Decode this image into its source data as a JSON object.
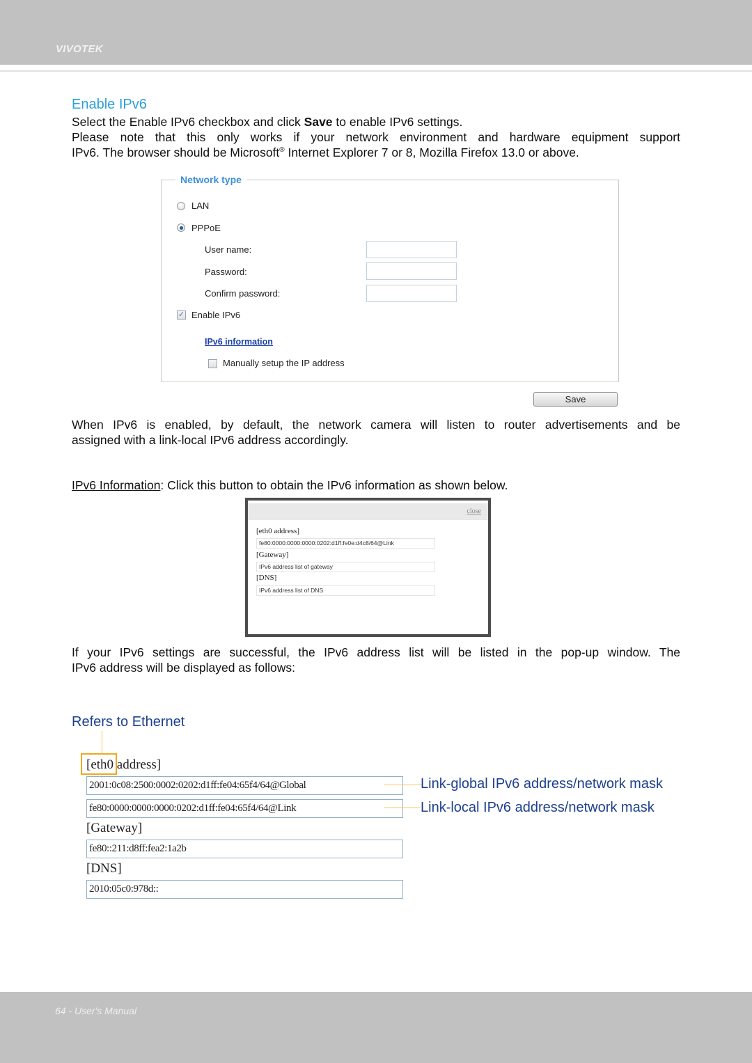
{
  "header": {
    "brand": "VIVOTEK"
  },
  "section1": {
    "title": "Enable IPv6",
    "intro_pre": "Select the Enable IPv6 checkbox and click ",
    "intro_bold": "Save",
    "intro_post": " to enable IPv6 settings.",
    "note_line1": "Please note that this only works if your network environment and hardware equipment support",
    "note_line2_pre": "IPv6. The browser should be Microsoft",
    "note_sup": "®",
    "note_line2_post": " Internet Explorer 7 or 8, Mozilla Firefox 13.0 or above."
  },
  "network_panel": {
    "legend": "Network type",
    "radios": [
      {
        "label": "LAN",
        "checked": false
      },
      {
        "label": "PPPoE",
        "checked": true
      }
    ],
    "fields": [
      {
        "label": "User name:",
        "value": ""
      },
      {
        "label": "Password:",
        "value": ""
      },
      {
        "label": "Confirm password:",
        "value": ""
      }
    ],
    "enable_ipv6": {
      "label": "Enable IPv6",
      "checked": true,
      "mark": "✓"
    },
    "ipv6_info_link": "IPv6 information",
    "manual_setup": {
      "label": "Manually setup the IP address",
      "checked": false
    },
    "save_label": "Save"
  },
  "para_enabled": {
    "line1": "When IPv6 is enabled, by default, the network camera will listen to router advertisements and be",
    "line2": "assigned with a link-local IPv6 address accordingly."
  },
  "para_info": {
    "link_text": "IPv6 Information",
    "rest": ": Click this button to obtain the IPv6 information as shown below."
  },
  "popup": {
    "close": "close",
    "sections": [
      {
        "heading": "[eth0 address]",
        "value": "fe80:0000:0000:0000:0202:d1ff:fe0e:d4c8/64@Link"
      },
      {
        "heading": "[Gateway]",
        "value": "IPv6 address list of gateway"
      },
      {
        "heading": "[DNS]",
        "value": "IPv6 address list of DNS"
      }
    ]
  },
  "para_success": {
    "line1": "If your IPv6 settings are successful, the IPv6 address list will be listed in the pop-up window. The",
    "line2": "IPv6 address will be displayed as follows:"
  },
  "ethernet": {
    "callout": "Refers to Ethernet",
    "eth_head_boxed": "[eth0",
    "eth_head_rest": " address]",
    "global_addr": "2001:0c08:2500:0002:0202:d1ff:fe04:65f4/64@Global",
    "link_addr": "fe80:0000:0000:0000:0202:d1ff:fe04:65f4/64@Link",
    "gateway_head": "[Gateway]",
    "gateway_addr": "fe80::211:d8ff:fea2:1a2b",
    "dns_head": "[DNS]",
    "dns_addr": "2010:05c0:978d::",
    "annot_global": "Link-global IPv6 address/network mask",
    "annot_local": "Link-local IPv6 address/network mask"
  },
  "colors": {
    "section_title": "#2a9fd8",
    "annotation": "#1d3f8f",
    "callout_line": "#f7c460",
    "callout_box": "#f0a81e",
    "band": "#c0c1c0"
  },
  "footer": {
    "text": "64 - User's Manual"
  }
}
